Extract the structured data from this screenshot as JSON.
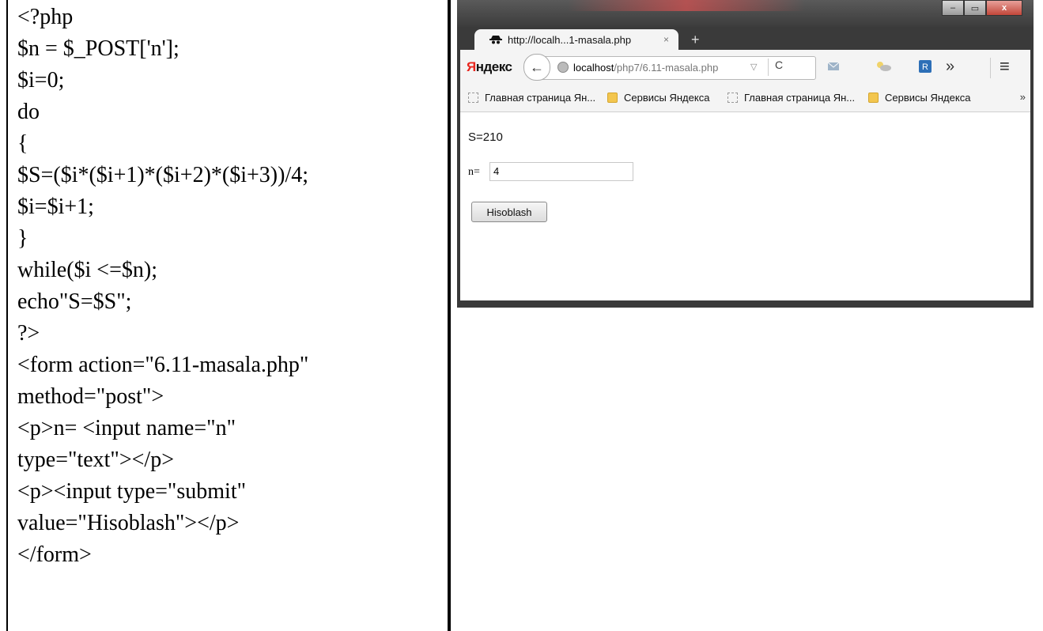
{
  "code": {
    "lines": [
      "<?php",
      "$n = $_POST['n'];",
      "$i=0;",
      "do",
      "{",
      "$S=($i*($i+1)*($i+2)*($i+3))/4;",
      "$i=$i+1;",
      "}",
      "while($i <=$n);",
      "echo\"S=$S\";",
      "?>",
      "<form action=\"6.11-masala.php\"",
      "method=\"post\">",
      "<p>n= <input name=\"n\"",
      "type=\"text\"></p>",
      "<p><input type=\"submit\"",
      "value=\"Hisoblash\"></p>",
      "</form>"
    ]
  },
  "browser": {
    "tab_title": "http://localh...1-masala.php",
    "tab_close": "×",
    "new_tab": "+",
    "window_buttons": {
      "minimize": "–",
      "maximize": "▭",
      "close": "x"
    },
    "yandex": {
      "first": "Я",
      "rest": "ндекс"
    },
    "url": {
      "host": "localhost",
      "path": "/php7/6.11-masala.php"
    },
    "toolbar_more": "»",
    "menu": "≡",
    "bookmarks": [
      {
        "label": "Главная страница Ян...",
        "icon": "page-icon"
      },
      {
        "label": "Сервисы Яндекса",
        "icon": "folder-icon"
      },
      {
        "label": "Главная страница Ян...",
        "icon": "page-icon"
      },
      {
        "label": "Сервисы Яндекса",
        "icon": "folder-icon"
      }
    ],
    "bookmarks_more": "»",
    "page": {
      "result_text": "S=210",
      "n_label": "n=",
      "n_value": "4",
      "submit_label": "Hisoblash"
    },
    "colors": {
      "accent_red": "#e8261e",
      "folder": "#f3c64f"
    }
  }
}
